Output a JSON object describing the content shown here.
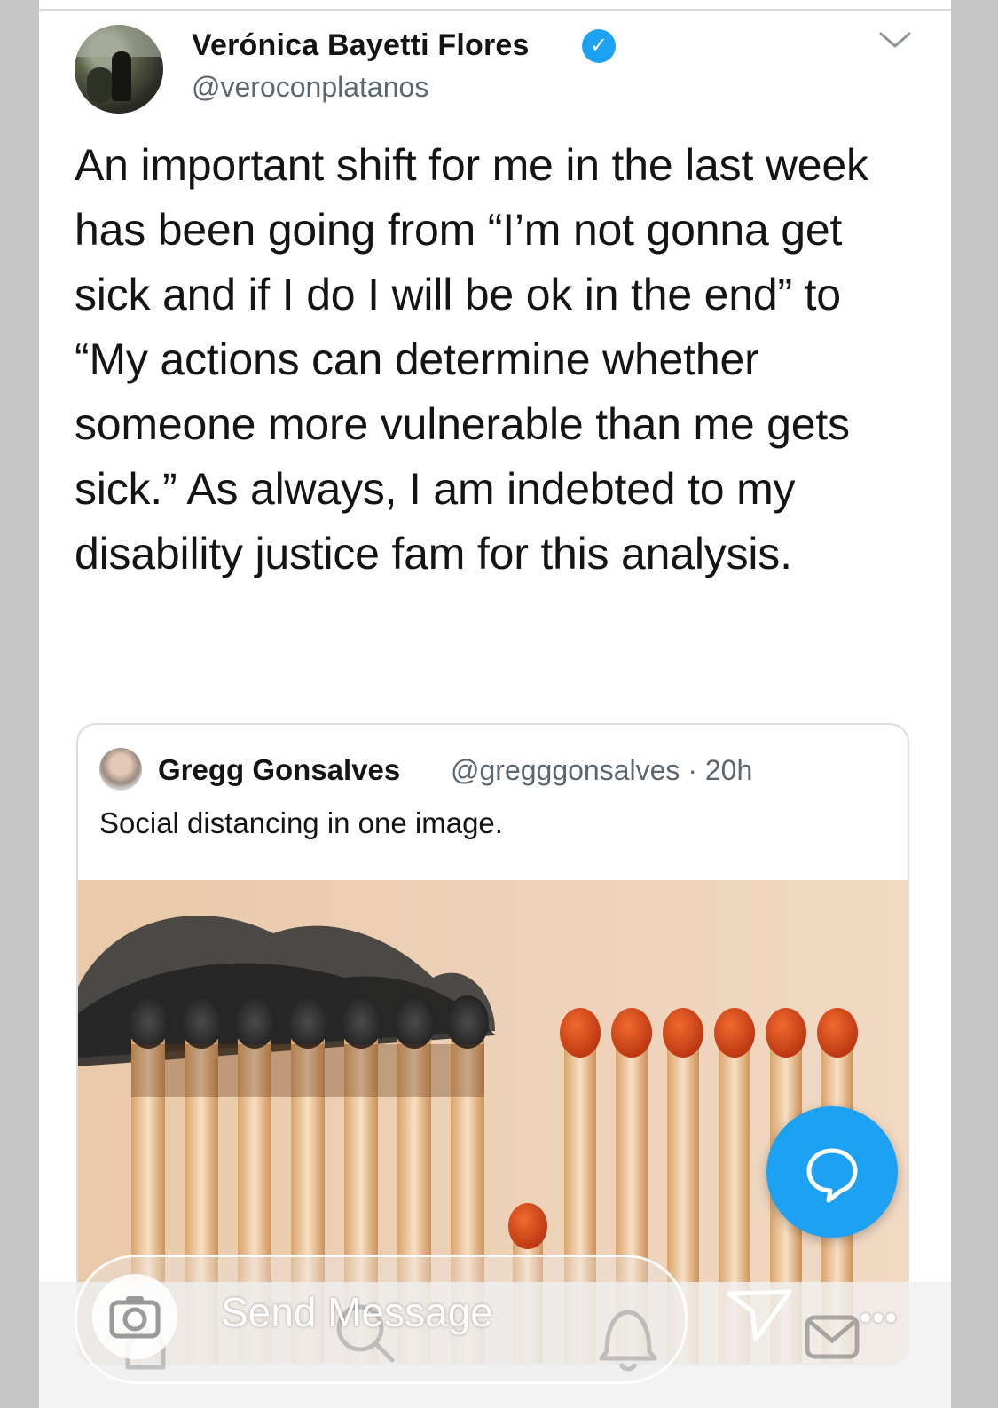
{
  "tweet": {
    "author_name": "Verónica Bayetti Flores",
    "author_handle": "@veroconplatanos",
    "verified_icon": "verified-check-icon",
    "text": "An important shift for me in the last week has been going from “I’m not gonna get sick and if I do I will be ok in the end” to “My actions can determine whether someone more vulnerable than me gets sick.” As always, I am indebted to my disability justice fam for this analysis."
  },
  "quoted_tweet": {
    "author_name": "Gregg Gonsalves",
    "meta": "@gregggonsalves · 20h",
    "text": "Social distancing in one image."
  },
  "reply_bar": {
    "placeholder": "Send Message"
  },
  "colors": {
    "twitter_blue": "#1da1f2",
    "text": "#141414",
    "secondary": "#5b6670"
  },
  "icons": [
    "chevron-down-icon",
    "verified-check-icon",
    "compose-reply-icon",
    "camera-icon",
    "send-icon",
    "more-icon",
    "search-icon",
    "notifications-icon",
    "messages-icon"
  ]
}
